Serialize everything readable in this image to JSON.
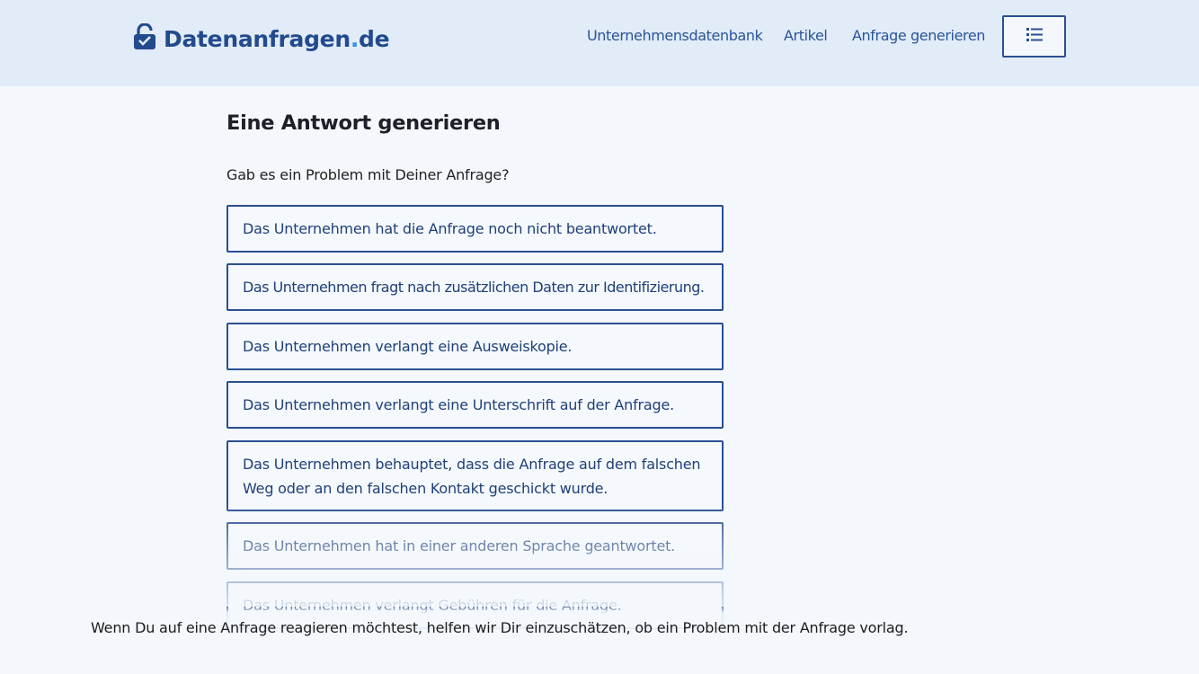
{
  "header": {
    "logo": {
      "name": "Datenanfragen",
      "dot": ".",
      "tld": "de",
      "icon": "lock-icon"
    },
    "nav": [
      {
        "label": "Unternehmensdatenbank"
      },
      {
        "label": "Artikel"
      },
      {
        "label": "Anfrage generieren"
      }
    ],
    "menu_icon": "list-icon"
  },
  "main": {
    "title": "Eine Antwort generieren",
    "question": "Gab es ein Problem mit Deiner Anfrage?",
    "options": [
      {
        "label": "Das Unternehmen hat die Anfrage noch nicht beantwortet."
      },
      {
        "label": "Das Unternehmen fragt nach zusätzlichen Daten zur Identifizierung."
      },
      {
        "label": "Das Unternehmen verlangt eine Ausweiskopie."
      },
      {
        "label": "Das Unternehmen verlangt eine Unterschrift auf der Anfrage."
      },
      {
        "label": "Das Unternehmen behauptet, dass die Anfrage auf dem falschen Weg oder an den falschen Kontakt geschickt wurde."
      },
      {
        "label": "Das Unternehmen hat in einer anderen Sprache geantwortet."
      },
      {
        "label": "Das Unternehmen verlangt Gebühren für die Anfrage."
      }
    ]
  },
  "footer": {
    "text": "Wenn Du auf eine Anfrage reagieren möchtest, helfen wir Dir einzuschätzen, ob ein Problem mit der Anfrage vorlag."
  },
  "colors": {
    "header_bg": "#e1ecf8",
    "page_bg": "#f4f8fc",
    "primary": "#2a4f92"
  }
}
